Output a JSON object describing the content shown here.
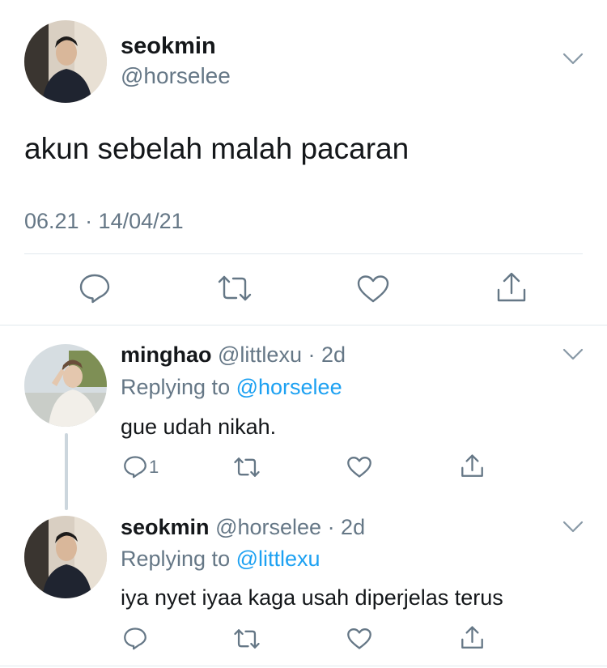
{
  "main_tweet": {
    "display_name": "seokmin",
    "handle": "@horselee",
    "text": "akun sebelah malah pacaran",
    "timestamp": "06.21 · 14/04/21",
    "avatar_icon": "user-photo-avatar",
    "actions": [
      "reply-icon",
      "retweet-icon",
      "like-icon",
      "share-icon"
    ]
  },
  "replies": [
    {
      "display_name": "minghao",
      "handle": "@littlexu",
      "time": "· 2d",
      "replying_prefix": "Replying to",
      "replying_to": "@horselee",
      "text": "gue udah nikah.",
      "reply_count": "1"
    },
    {
      "display_name": "seokmin",
      "handle": "@horselee",
      "time": "· 2d",
      "replying_prefix": "Replying to",
      "replying_to": "@littlexu",
      "text": "iya nyet iyaa kaga usah diperjelas terus",
      "reply_count": ""
    }
  ],
  "colors": {
    "text": "#14171a",
    "secondary": "#657786",
    "link": "#1da1f2",
    "separator": "#e1e8ed"
  }
}
